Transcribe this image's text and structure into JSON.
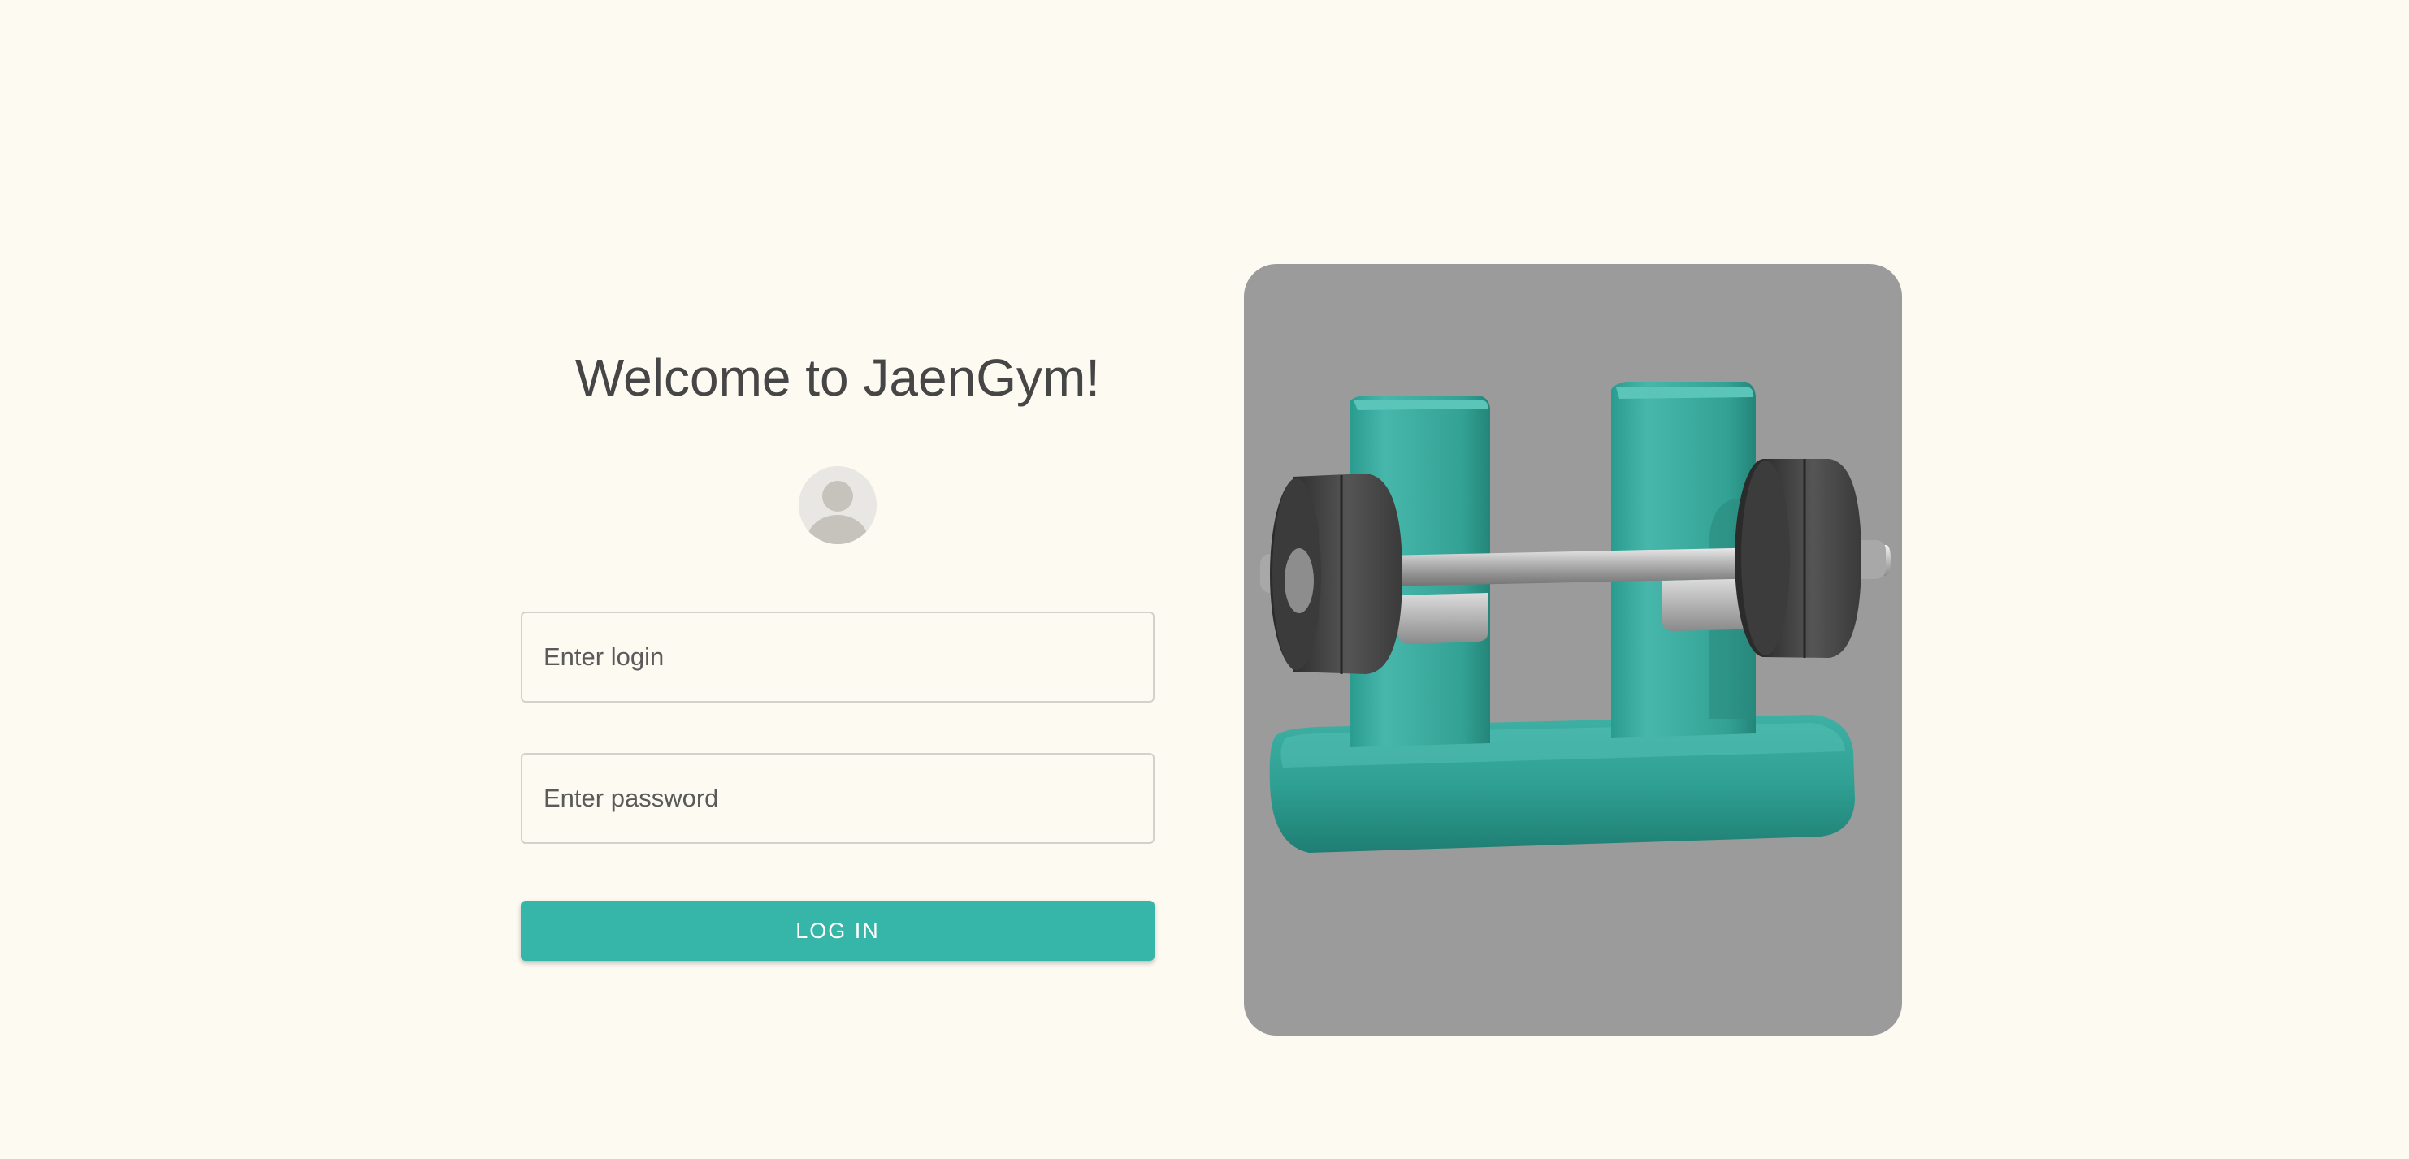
{
  "header": {
    "title": "Welcome to JaenGym!"
  },
  "form": {
    "login_placeholder": "Enter login",
    "password_placeholder": "Enter password",
    "submit_label": "LOG IN"
  },
  "icons": {
    "avatar": "user-avatar-icon",
    "illustration": "dumbbell-rack-illustration"
  },
  "colors": {
    "background": "#fdfaf2",
    "accent": "#36b5a9",
    "card_background": "#9b9b9b"
  }
}
